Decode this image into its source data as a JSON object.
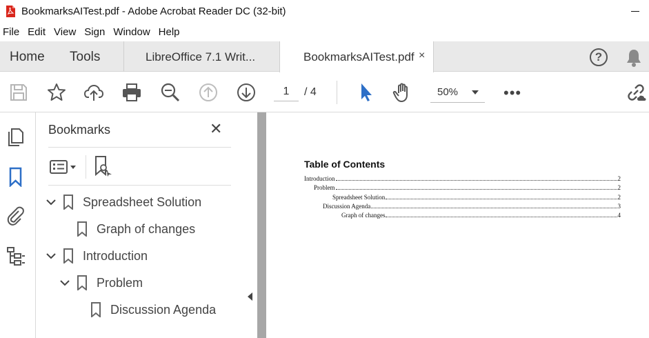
{
  "window": {
    "title": "BookmarksAITest.pdf - Adobe Acrobat Reader DC (32-bit)"
  },
  "menu": {
    "items": [
      "File",
      "Edit",
      "View",
      "Sign",
      "Window",
      "Help"
    ]
  },
  "tabs": {
    "home": "Home",
    "tools": "Tools",
    "doc1": "LibreOffice  7.1 Writ...",
    "doc2": "BookmarksAITest.pdf",
    "close_glyph": "×"
  },
  "toolbar": {
    "page_current": "1",
    "page_total": "/  4",
    "zoom": "50%",
    "more": "•••",
    "help_glyph": "?"
  },
  "bookmarks_panel": {
    "title": "Bookmarks",
    "close_glyph": "✕",
    "items": [
      {
        "label": "Spreadsheet Solution",
        "level": 0,
        "expanded": true
      },
      {
        "label": "Graph of changes",
        "level": 1,
        "expanded": null
      },
      {
        "label": "Introduction",
        "level": 0,
        "expanded": true
      },
      {
        "label": "Problem",
        "level": 1,
        "expanded": true
      },
      {
        "label": "Discussion Agenda",
        "level": 2,
        "expanded": null
      }
    ]
  },
  "document": {
    "toc_title": "Table of Contents",
    "toc_entries": [
      {
        "text": "Introduction",
        "page": "2"
      },
      {
        "text": "Problem",
        "page": "2"
      },
      {
        "text": "Spreadsheet Solution",
        "page": "2"
      },
      {
        "text": "Discussion Agenda",
        "page": "3"
      },
      {
        "text": "Graph of changes",
        "page": "4"
      }
    ]
  },
  "colors": {
    "accent_blue": "#2d6fc7",
    "icon_gray": "#555555",
    "pdf_red": "#d9261c"
  }
}
